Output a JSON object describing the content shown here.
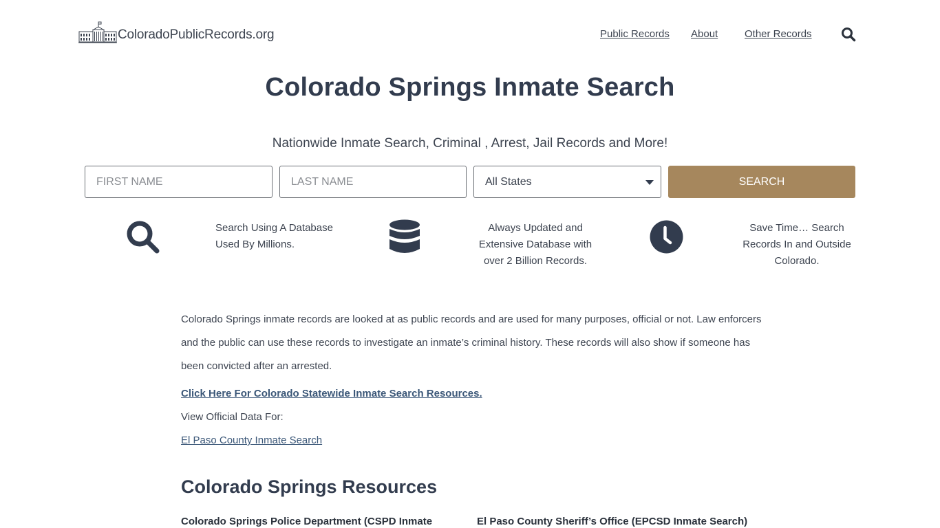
{
  "header": {
    "logo_text": "ColoradoPublicRecords.org",
    "nav": [
      {
        "label": "Public Records"
      },
      {
        "label": "About"
      },
      {
        "label": "Other Records"
      }
    ],
    "search_icon": "search-icon"
  },
  "hero": {
    "title": "Colorado Springs Inmate Search",
    "subtitle": "Nationwide Inmate Search, Criminal , Arrest, Jail Records and More!"
  },
  "search_form": {
    "first_name": {
      "value": "",
      "placeholder": "FIRST NAME"
    },
    "last_name": {
      "value": "",
      "placeholder": "LAST NAME"
    },
    "state_select": {
      "selected": "All States"
    },
    "search_button": "SEARCH"
  },
  "features": [
    {
      "icon": "search-icon",
      "text": "Search Using A Database Used By Millions."
    },
    {
      "icon": "database-icon",
      "text": "Always Updated and Extensive Database with over 2 Billion Records."
    },
    {
      "icon": "clock-icon",
      "text": "Save Time… Search Records In and Outside Colorado."
    }
  ],
  "content": {
    "intro": "Colorado Springs inmate records are looked at as public records and are used for many purposes, official or not. Law enforcers and the public can use these records to investigate an inmate’s criminal history. These records will also show if someone has been convicted after an arrested.",
    "statewide_link": "Click Here For Colorado Statewide Inmate Search Resources.",
    "official_label": "View Official Data For:",
    "county_link": "El Paso County Inmate Search",
    "section_title": "Colorado Springs Resources",
    "resources": [
      {
        "title": "Colorado Springs Police Department (CSPD Inmate"
      },
      {
        "title": "El Paso County Sheriff’s Office (EPCSD Inmate Search)"
      }
    ]
  },
  "colors": {
    "heading": "#323c4e",
    "text": "#3d4450",
    "link": "#3b5778",
    "button": "#a6875d",
    "icon": "#323c4e"
  }
}
